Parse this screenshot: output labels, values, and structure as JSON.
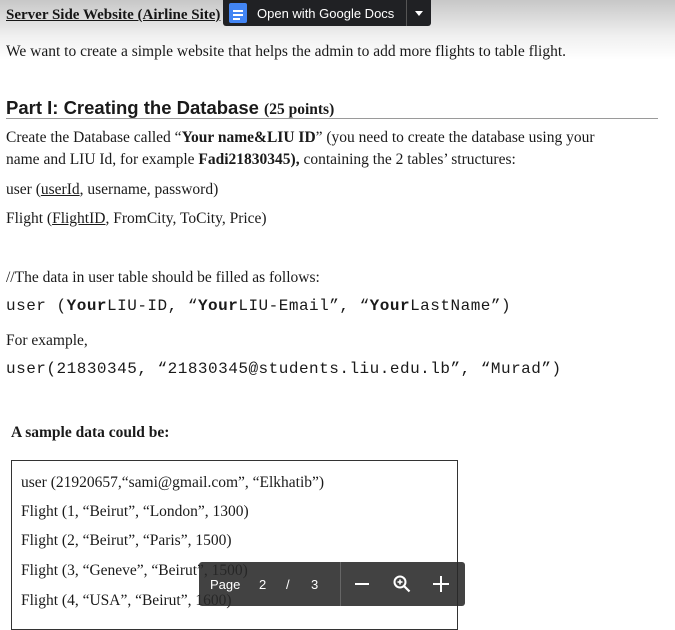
{
  "header": {
    "title": "Server Side Website (Airline Site)"
  },
  "open_with": {
    "label": "Open with Google Docs",
    "icon": "google-docs-icon"
  },
  "intro": "We want to create a simple website that helps the admin to add more flights to table flight.",
  "part1": {
    "heading": "Part I: Creating the Database",
    "points": "(25 points)",
    "line1_a": "Create the Database called “",
    "line1_b": "Your name&LIU ID",
    "line1_c": "” (you need to create the database using your",
    "line2_a": "name and LIU Id, for example ",
    "line2_b": "Fadi21830345),",
    "line2_c": " containing the 2 tables’ structures:",
    "user_a": "user (",
    "user_key": "userId",
    "user_b": ", username, password)",
    "flight_a": "Flight (",
    "flight_key": "FlightID",
    "flight_b": ", FromCity, ToCity, Price)",
    "comment": "//The data in user table should be filled as follows:",
    "code1_a": "user (",
    "code1_b": "Your",
    "code1_c": "LIU-ID, “",
    "code1_d": "Your",
    "code1_e": "LIU-Email”, “",
    "code1_f": "Your",
    "code1_g": "LastName”)",
    "example": "For example,",
    "code2": "user(21830345, “21830345@students.liu.edu.lb”, “Murad”)",
    "sample_title": "A sample data could be:"
  },
  "sample_lines": [
    "user (21920657,“sami@gmail.com”, “Elkhatib”)",
    "Flight (1, “Beirut”, “London”, 1300)",
    "Flight (2, “Beirut”, “Paris”, 1500)",
    "Flight (3, “Geneve”, “Beirut”, 1500)",
    "Flight (4, “USA”, “Beirut”, 1600)"
  ],
  "pager": {
    "label": "Page",
    "current": "2",
    "separator": "/",
    "total": "3"
  }
}
